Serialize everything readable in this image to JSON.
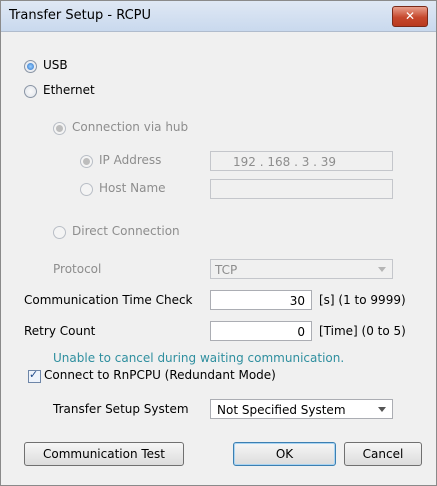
{
  "window": {
    "title": "Transfer Setup - RCPU",
    "close_glyph": "✕"
  },
  "connection": {
    "usb_label": "USB",
    "ethernet_label": "Ethernet"
  },
  "hub": {
    "connection_via_hub_label": "Connection via hub",
    "ip_address_label": "IP Address",
    "ip_address_value": "192 . 168 .  3  .  39",
    "host_name_label": "Host Name",
    "host_name_value": "",
    "direct_connection_label": "Direct Connection"
  },
  "protocol": {
    "label": "Protocol",
    "value": "TCP"
  },
  "comm_time_check": {
    "label": "Communication Time Check",
    "value": "30",
    "unit_range": "[s]  (1 to 9999)"
  },
  "retry": {
    "label": "Retry Count",
    "value": "0",
    "unit_range": "[Time]  (0 to 5)"
  },
  "note": "Unable to cancel during waiting communication.",
  "redundant": {
    "label": "Connect to RnPCPU (Redundant Mode)",
    "checked": true
  },
  "transfer_system": {
    "label": "Transfer Setup System",
    "value": "Not Specified System"
  },
  "buttons": {
    "communication_test": "Communication Test",
    "ok": "OK",
    "cancel": "Cancel"
  },
  "colors": {
    "note": "#2f8f9f",
    "accent": "#2a6fc6"
  }
}
